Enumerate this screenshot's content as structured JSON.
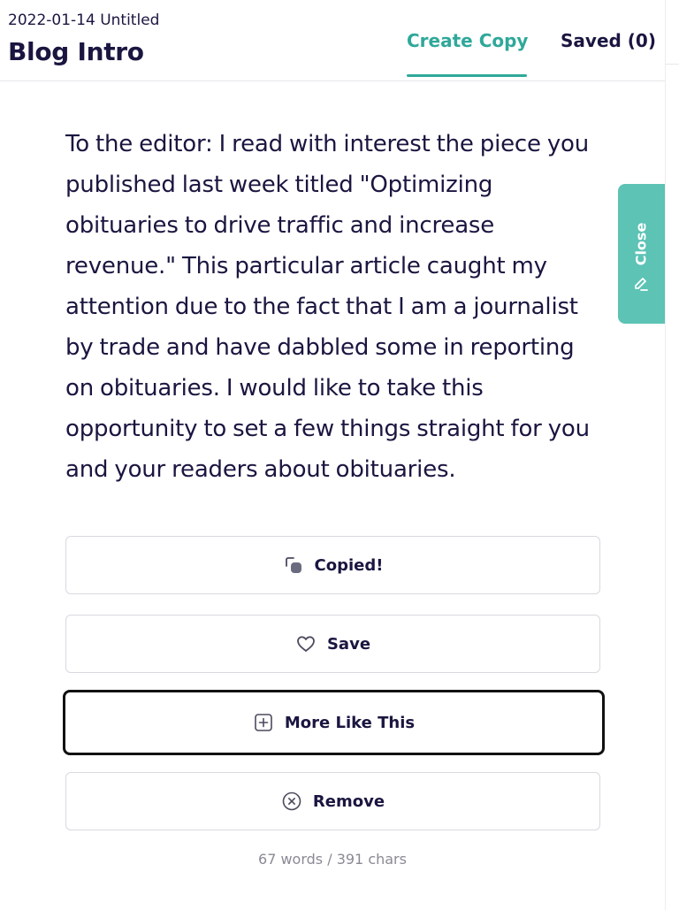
{
  "header": {
    "doc_meta": "2022-01-14 Untitled",
    "doc_title": "Blog Intro",
    "tabs": [
      {
        "label": "Create Copy",
        "active": true
      },
      {
        "label": "Saved (0)",
        "active": false
      }
    ]
  },
  "result": {
    "text": "To the editor: I read with interest the piece you published last week titled \"Optimizing obituaries to drive traffic and increase revenue.\" This particular article caught my attention due to the fact that I am a journalist by trade and have dabbled some in reporting on obituaries. I would like to take this opportunity to set a few things straight for you and your readers about obituaries.",
    "stats": "67 words / 391 chars"
  },
  "actions": {
    "copy_label": "Copied!",
    "save_label": "Save",
    "more_label": "More Like This",
    "remove_label": "Remove"
  },
  "side_panel": {
    "close_label": "Close"
  },
  "icons": {
    "copy": "copy-icon",
    "save": "heart-icon",
    "more": "plus-square-icon",
    "remove": "x-circle-icon",
    "close": "pencil-icon"
  },
  "colors": {
    "accent": "#2fa89a",
    "close_tab": "#5cc3b5",
    "text": "#1a1640",
    "muted": "#8a8a95",
    "focus_border": "#111111"
  }
}
